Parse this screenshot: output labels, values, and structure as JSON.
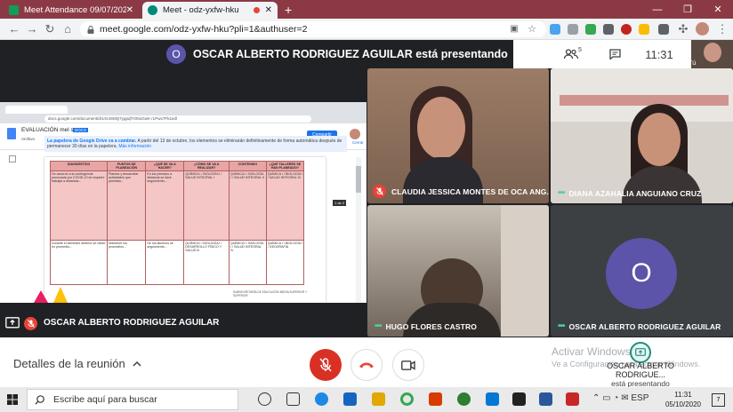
{
  "browser": {
    "tabs": [
      {
        "title": "Meet Attendance 09/07/2020 - H",
        "active": false
      },
      {
        "title": "Meet - odz-yxfw-hku",
        "active": true
      }
    ],
    "new_tab": "+",
    "url": "meet.google.com/odz-yxfw-hku?pli=1&authuser=2"
  },
  "meet": {
    "presenting_banner": "OSCAR ALBERTO RODRIGUEZ AGUILAR está presentando",
    "banner_avatar_letter": "O",
    "participants_count": "5",
    "time": "11:31",
    "self_label": "Tú",
    "presenter_bar_name": "OSCAR ALBERTO RODRIGUEZ AGUILAR",
    "tiles": [
      {
        "name": "CLAUDIA JESSICA MONTES DE OCA ANG...",
        "muted": true
      },
      {
        "name": "DIANA AZAHALIA ANGUIANO CRUZ",
        "muted": false
      },
      {
        "name": "HUGO FLORES CASTRO",
        "muted": false
      },
      {
        "name": "OSCAR ALBERTO RODRIGUEZ AGUILAR",
        "muted": false,
        "avatar_letter": "O"
      }
    ],
    "details_label": "Detalles de la reunión",
    "presenting_tile_name": "OSCAR ALBERTO RODRIGUE...",
    "presenting_tile_sub": "está presentando"
  },
  "presentation": {
    "doc_title": "EVALUACIÓN mel sep",
    "doc_badge": "DOCX",
    "doc_menu": "Archivo",
    "share_label": "Compartir",
    "url": "docs.google.com/document/d/1rG4SMQ7ygpqfYO6oGwK rLPwx7Fk1edl",
    "notice_title": "La papelera de Google Drive va a cambiar.",
    "notice_text": "A partir del 13 de octubre, los elementos se eliminarán definitivamente de forma automática después de permanecer 30 días en la papelera.",
    "notice_link": "Más información",
    "notice_close": "Cerrar",
    "page_badge": "1 de 2",
    "headers": [
      "DIAGNÓSTICO",
      "PUNTOS DE PLANEACIÓN",
      "¿QUÉ SE VA A HACER?",
      "¿CÓMO SE VA A REALIZAR?",
      "CONTENIDO",
      "¿QUÉ TALLERES SE HAN PLANEADO?"
    ],
    "rows": [
      [
        "De acuerdo a la contingencia provocada por COVID-19 se requiere trabajar a distancia...",
        "Planear y desarrollar actividades que permitan...",
        "En los periodos a distancia se dará seguimiento...",
        "QUÍMICA I / BIOLOGÍA I / SALUD INTEGRAL I",
        "QUÍMICA I / BIOLOGÍA I / SALUD INTEGRAL II",
        "QUÍMICA I / BIOLOGÍA I / SALUD INTEGRAL III"
      ],
      [
        "Durante el semestre anterior se utilizó en promedio...",
        "Mantener los promedios...",
        "De los alumnos se seguimiento...",
        "QUÍMICA I / BIOLOGÍA I / DESARROLLO FÍSICO Y SALUD III",
        "QUÍMICA I / BIOLOGÍA I / SALUD INTEGRAL IV",
        "QUÍMICA I / BIOLOGÍA I / GEOGRAFÍA"
      ]
    ],
    "footer": "SUBSECRETARÍA DE EDUCACIÓN MEDIA SUPERIOR Y SUPERIOR"
  },
  "watermark": {
    "line1": "Activar Windows",
    "line2": "Ve a Configuración para activar Windows."
  },
  "taskbar": {
    "search_placeholder": "Escribe aquí para buscar",
    "time": "11:31",
    "date": "05/10/2020",
    "notifications": "7"
  },
  "colors": {
    "tab_strip": "#8b3a45",
    "meet_bg": "#202124",
    "hangup": "#ea4335",
    "mic_off": "#d93025",
    "avatar": "#5c54a8",
    "table_header": "#e8a5a5"
  }
}
